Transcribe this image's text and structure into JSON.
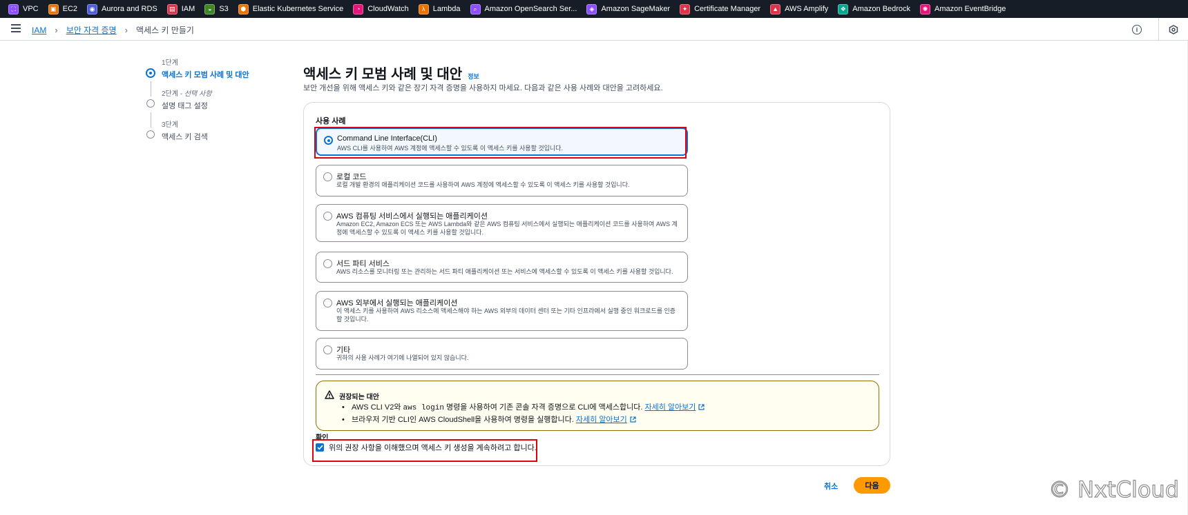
{
  "favorites": [
    {
      "label": "VPC",
      "icon": "vpc-icon",
      "color": "#8c4fff"
    },
    {
      "label": "EC2",
      "icon": "ec2-icon",
      "color": "#ed7100"
    },
    {
      "label": "Aurora and RDS",
      "icon": "rds-icon",
      "color": "#4d5cdb"
    },
    {
      "label": "IAM",
      "icon": "iam-icon",
      "color": "#dd344c"
    },
    {
      "label": "S3",
      "icon": "s3-icon",
      "color": "#3f8624"
    },
    {
      "label": "Elastic Kubernetes Service",
      "icon": "eks-icon",
      "color": "#ed7100"
    },
    {
      "label": "CloudWatch",
      "icon": "cloudwatch-icon",
      "color": "#e7157b"
    },
    {
      "label": "Lambda",
      "icon": "lambda-icon",
      "color": "#ed7100"
    },
    {
      "label": "Amazon OpenSearch Ser...",
      "icon": "opensearch-icon",
      "color": "#8c4fff"
    },
    {
      "label": "Amazon SageMaker",
      "icon": "sagemaker-icon",
      "color": "#8c4fff"
    },
    {
      "label": "Certificate Manager",
      "icon": "certificate-icon",
      "color": "#dd344c"
    },
    {
      "label": "AWS Amplify",
      "icon": "amplify-icon",
      "color": "#dd344c"
    },
    {
      "label": "Amazon Bedrock",
      "icon": "bedrock-icon",
      "color": "#01a88d"
    },
    {
      "label": "Amazon EventBridge",
      "icon": "eventbridge-icon",
      "color": "#e7157b"
    }
  ],
  "breadcrumb": {
    "root": "IAM",
    "parent": "보안 자격 증명",
    "current": "액세스 키 만들기"
  },
  "steps": [
    {
      "number": "1단계",
      "optional": "",
      "title": "액세스 키 모범 사례 및 대안",
      "active": true
    },
    {
      "number": "2단계 - ",
      "optional": "선택 사항",
      "title": "설명 태그 설정",
      "active": false
    },
    {
      "number": "3단계",
      "optional": "",
      "title": "액세스 키 검색",
      "active": false
    }
  ],
  "page": {
    "title": "액세스 키 모범 사례 및 대안",
    "info_link": "정보",
    "subtitle": "보안 개선을 위해 액세스 키와 같은 장기 자격 증명을 사용하지 마세요. 다음과 같은 사용 사례와 대안을 고려하세요."
  },
  "use_case": {
    "label": "사용 사례",
    "selected_index": 0,
    "options": [
      {
        "title": "Command Line Interface(CLI)",
        "desc": "AWS CLI를 사용하여 AWS 계정에 액세스할 수 있도록 이 액세스 키를 사용할 것입니다."
      },
      {
        "title": "로컬 코드",
        "desc": "로컬 개발 환경의 애플리케이션 코드를 사용하여 AWS 계정에 액세스할 수 있도록 이 액세스 키를 사용할 것입니다."
      },
      {
        "title": "AWS 컴퓨팅 서비스에서 실행되는 애플리케이션",
        "desc": "Amazon EC2, Amazon ECS 또는 AWS Lambda와 같은 AWS 컴퓨팅 서비스에서 실행되는 애플리케이션 코드를 사용하여 AWS 계정에 액세스할 수 있도록 이 액세스 키를 사용할 것입니다."
      },
      {
        "title": "서드 파티 서비스",
        "desc": "AWS 리소스를 모니터링 또는 관리하는 서드 파티 애플리케이션 또는 서비스에 액세스할 수 있도록 이 액세스 키를 사용할 것입니다."
      },
      {
        "title": "AWS 외부에서 실행되는 애플리케이션",
        "desc": "이 액세스 키를 사용하여 AWS 리소스에 액세스해야 하는 AWS 외부의 데이터 센터 또는 기타 인프라에서 실행 중인 워크로드를 인증할 것입니다."
      },
      {
        "title": "기타",
        "desc": "귀하의 사용 사례가 여기에 나열되어 있지 않습니다."
      }
    ]
  },
  "alert": {
    "title": "권장되는 대안",
    "item1_pre": "AWS CLI V2와 ",
    "item1_code": "aws login",
    "item1_post": " 명령을 사용하여 기존 콘솔 자격 증명으로 CLI에 액세스합니다. ",
    "item2_pre": "브라우저 기반 CLI인 AWS CloudShell을 사용하여 명령을 실행합니다. ",
    "learn_more": "자세히 알아보기"
  },
  "confirm": {
    "label": "확인",
    "checkbox_text": "위의 권장 사항을 이해했으며 액세스 키 생성을 계속하려고 합니다.",
    "checked": true
  },
  "actions": {
    "cancel": "취소",
    "next": "다음"
  },
  "watermark": "© NxtCloud",
  "colors": {
    "accent": "#0972d3",
    "primary_button": "#ff9900",
    "highlight": "#e0000c",
    "top_bar": "#161d26"
  }
}
